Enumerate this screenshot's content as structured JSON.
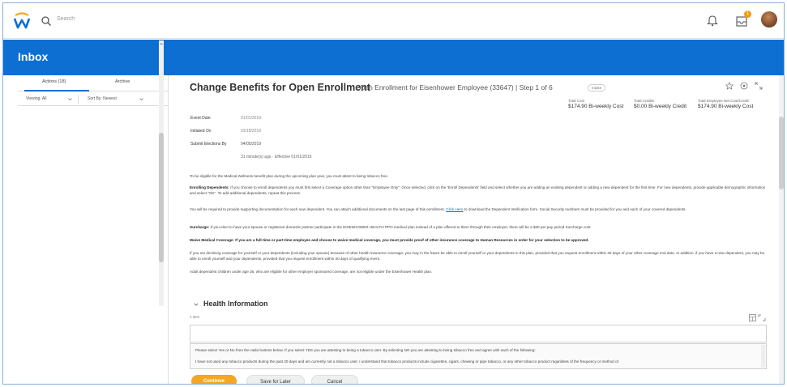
{
  "app": {
    "brand_color": "#0d6fd1",
    "accent_color": "#f5a623",
    "notification_count": "1"
  },
  "search": {
    "placeholder": "Search"
  },
  "header": {
    "title": "Inbox"
  },
  "sidebar": {
    "tabs": [
      {
        "label": "Actions (18)"
      },
      {
        "label": "Archive"
      }
    ],
    "filters": [
      {
        "label": "Viewing: All"
      },
      {
        "label": "Sort By: Newest"
      }
    ]
  },
  "task": {
    "title": "Change Benefits for Open Enrollment",
    "subtitle": "Open Enrollment for Eisenhower Employee (33647) | Step 1 of 6",
    "status_pill": "Intake",
    "costs": [
      {
        "label": "Total Cost",
        "value": "$174.90 Bi-weekly Cost"
      },
      {
        "label": "Total Credits",
        "value": "$0.00 Bi-weekly Credit"
      },
      {
        "label": "Total Employee Net Cost/Credit",
        "value": "$174.90 Bi-weekly Cost"
      }
    ],
    "fields": [
      {
        "label": "Event Date",
        "value": "01/01/2019"
      },
      {
        "label": "Initiated On",
        "value": "03/18/2019"
      },
      {
        "label": "Submit Elections By",
        "value": "04/05/2019"
      }
    ],
    "timing": "31 minute(s) ago · Effective 01/01/2019"
  },
  "instructions": {
    "p1": "To be eligible for the Medical Wellness benefit plan during the upcoming plan year, you must attest to being tobacco free.",
    "p2_bold": "Enrolling Dependents:",
    "p2": " If you choose to enroll dependents you must first select a Coverage option other than \"Employee Only\". Once selected, click on the 'Enroll Dependents' field and select whether you are adding an existing dependent or adding a new dependent for the first time. For new dependents, provide applicable demographic information and select \"OK\". To add additional dependents, repeat this process.",
    "p3a": "You will be required to provide supporting documentation for each new dependent. You can attach additional documents on the last page of this enrollment.",
    "p3_link": "Click Here",
    "p3b": " to download the Dependent Verification form. Social Security numbers must be provided for you and each of your covered dependents.",
    "p4_bold": "Surcharge:",
    "p4": " If you elect to have your spouse or registered domestic partner participate in the EISENHOWER HEALTH PPO medical plan instead of a plan offered to them through their employer, there will be a $30 per pay period Surcharge cost.",
    "p5_bold": "Waive Medical Coverage: If you are a full-time or part-time employee and choose to waive medical coverage, you must provide proof of other insurance coverage to Human Resources in order for your selection to be approved.",
    "p6": "If you are declining coverage for yourself or your dependents (including your spouse) because of other health insurance coverage, you may in the future be able to enroll yourself or your dependents in this plan, provided that you request enrollment within 30 days of your other coverage end date. In addition, if you have a new dependent, you may be able to enroll yourself and your dependents, provided that you request enrollment within 30 days of qualifying event.",
    "p7": "Adult dependent children under age 26, who are eligible for other employer sponsored coverage, are not eligible under the Eisenhower Health plan."
  },
  "health": {
    "section_title": "Health Information",
    "items_label": "1 item",
    "question_line1": "Please select Yes or No from the radio buttons below. If you select YES you are attesting to being a tobacco user. By selecting NO you are attesting to being tobacco free and agree with each of the following:",
    "question_line2": "I have not used any tobacco products during the past 30 days and am currently not a tobacco user. I understand that tobacco products include cigarettes, cigars, chewing or pipe tobacco, or any other tobacco product regardless of the frequency or method of"
  },
  "footer": {
    "continue_label": "Continue",
    "save_label": "Save for Later",
    "cancel_label": "Cancel"
  }
}
